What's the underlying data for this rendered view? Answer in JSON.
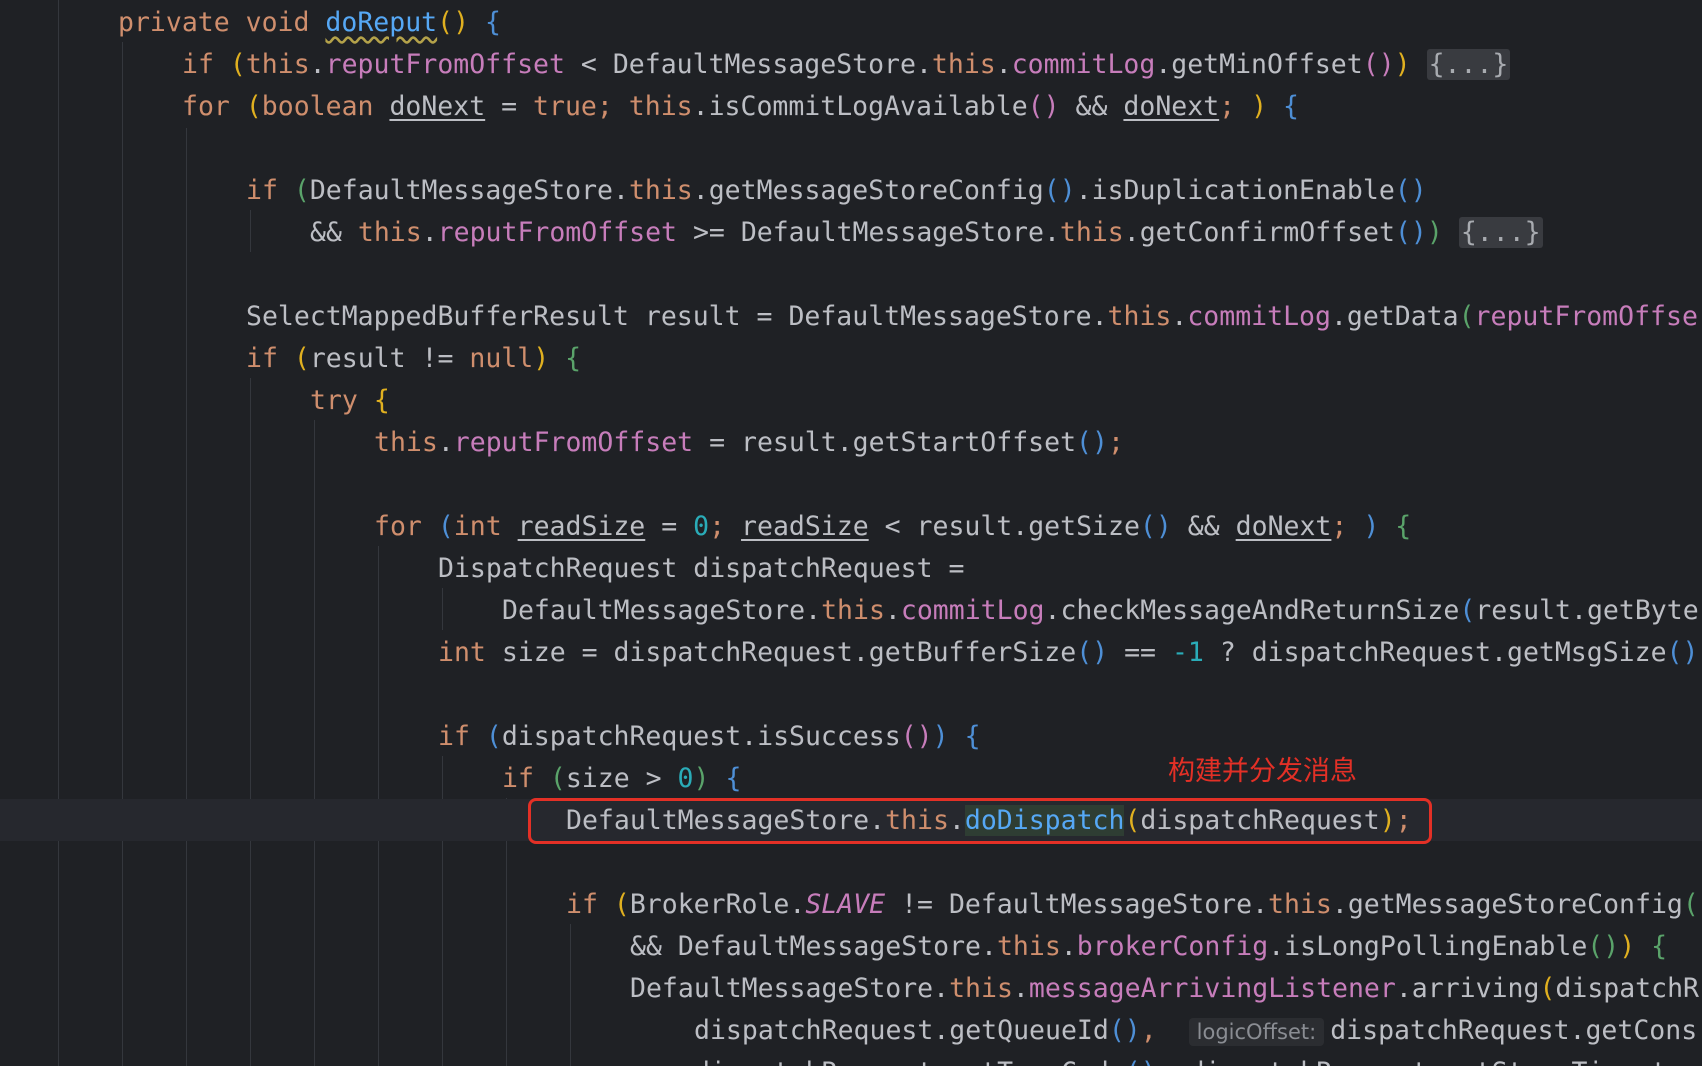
{
  "editor": {
    "annotation_text": "构建并分发消息",
    "fold_placeholder": "{...}",
    "inlay_hint": "logicOffset:",
    "code": {
      "sig_kw": "private void ",
      "sig_name": "doReput",
      "l2": {
        "a": "this",
        "b": "reputFromOffset",
        "c": " < DefaultMessageStore.",
        "d": "this",
        "e": "commitLog",
        "f": ".getMinOffset"
      },
      "l3": {
        "a": "for ",
        "b": "boolean ",
        "c": "doNext",
        "d": " = ",
        "e": "true",
        "f": "; ",
        "g": "this",
        ".h": "",
        "h": ".isCommitLogAvailable",
        "i": " && ",
        "j": "doNext",
        "k": "; "
      },
      "l5": {
        "a": "DefaultMessageStore.",
        "b": "this",
        ".c": "",
        "c": ".getMessageStoreConfig",
        "d": ".isDuplicationEnable"
      },
      "l6": {
        "a": "&& ",
        "b": "this",
        "c": "reputFromOffset",
        "d": " >= DefaultMessageStore.",
        "e": "this",
        "f": ".getConfirmOffset"
      },
      "l8": {
        "a": "SelectMappedBufferResult result = DefaultMessageStore.",
        "b": "this",
        "c": "commitLog",
        "d": ".getData",
        "e": "reputFromOffse"
      },
      "l9": {
        "a": "result != ",
        "b": "null"
      },
      "l10": {
        "a": "try "
      },
      "l11": {
        "a": "this",
        "b": "reputFromOffset",
        "c": " = result.getStartOffset"
      },
      "l13": {
        "a": "for ",
        "b": "int ",
        "c": "readSize",
        "d": " = ",
        "e": "0",
        "f": "; ",
        "g": "readSize",
        "h": " < result.getSize",
        "i": " && ",
        "j": "doNext",
        "k": "; "
      },
      "l14": {
        "a": "DispatchRequest dispatchRequest ="
      },
      "l15": {
        "a": "DefaultMessageStore.",
        "b": "this",
        "c": "commitLog",
        "d": ".checkMessageAndReturnSize",
        "e": "result.getByte"
      },
      "l16": {
        "a": "int ",
        "b": "size = dispatchRequest.getBufferSize",
        "c": " == ",
        "d": "-1",
        "e": " ? dispatchRequest.getMsgSize"
      },
      "l18": {
        "a": "dispatchRequest.isSuccess"
      },
      "l19": {
        "a": "size > ",
        "b": "0"
      },
      "l20": {
        "a": "DefaultMessageStore.",
        "b": "this",
        "c": "doDispatch",
        "d": "dispatchRequest"
      },
      "l22": {
        "a": "BrokerRole.",
        "b": "SLAVE",
        "c": " != DefaultMessageStore.",
        "d": "this",
        "e": ".getMessageStoreConfig"
      },
      "l23": {
        "a": "&& DefaultMessageStore.",
        "b": "this",
        "c": "brokerConfig",
        "d": ".isLongPollingEnable"
      },
      "l24": {
        "a": "DefaultMessageStore.",
        "b": "this",
        "c": "messageArrivingListener",
        "d": ".arriving",
        "e": "dispatchR"
      },
      "l25": {
        "a": "dispatchRequest.getQueueId",
        "b": "dispatchRequest.getCons"
      },
      "l26": {
        "a": "dispatchRequest.getTagsCode",
        "b": "dispatchRequest.getStoreTimest"
      }
    }
  }
}
